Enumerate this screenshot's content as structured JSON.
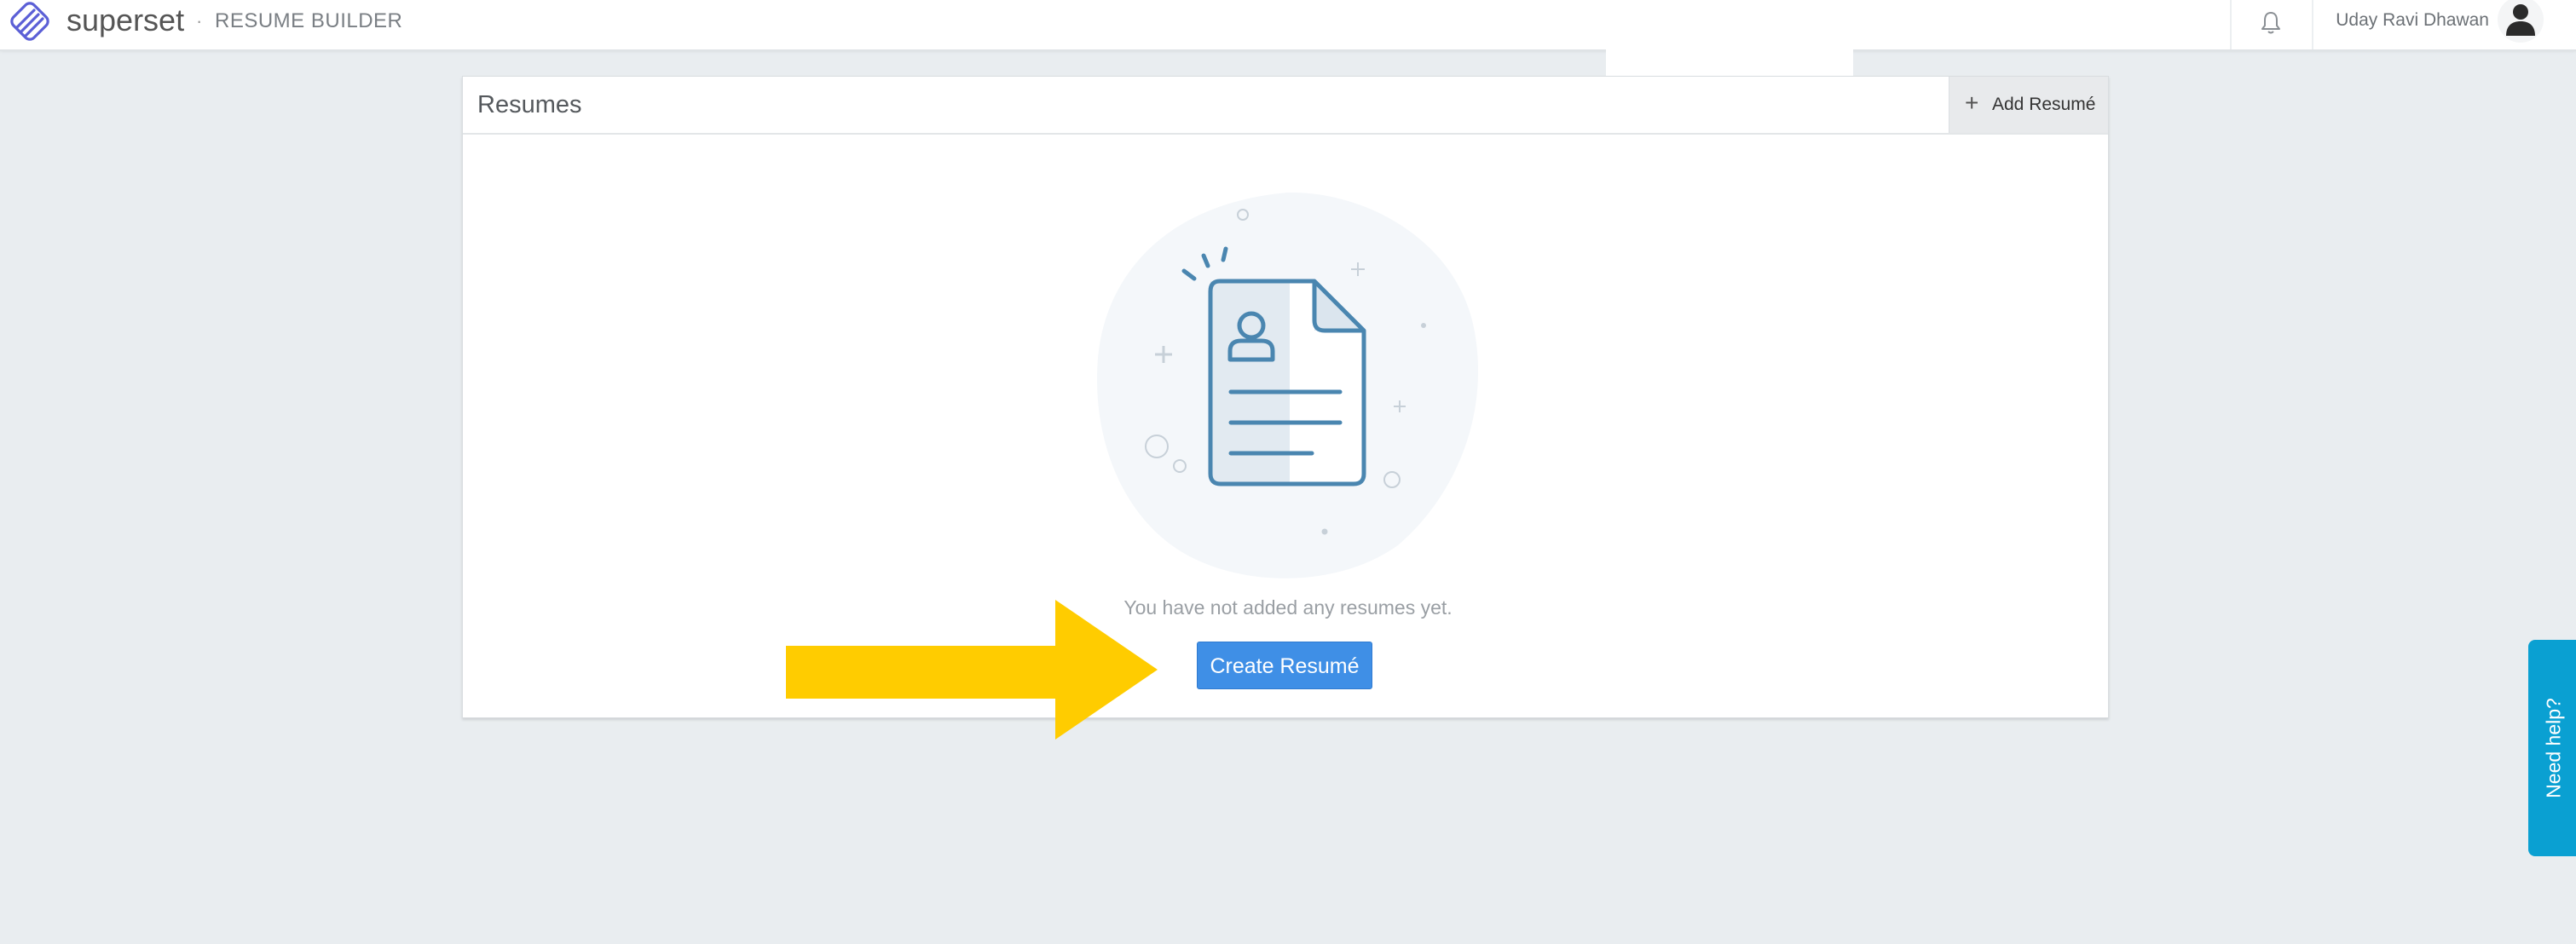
{
  "header": {
    "brand": "superset",
    "separator": "·",
    "product": "RESUME BUILDER",
    "user_name": "Uday Ravi Dhawan",
    "icons": {
      "logo": "superset-logo",
      "notifications": "bell-icon",
      "avatar": "user-avatar-icon"
    }
  },
  "card": {
    "title": "Resumes",
    "add_button_icon": "+",
    "add_button_label": "Add Resumé"
  },
  "empty_state": {
    "illustration": "resume-document-icon",
    "message": "You have not added any resumes yet.",
    "create_button_label": "Create Resumé"
  },
  "annotation": {
    "icon": "yellow-arrow-icon",
    "color": "#ffcc00"
  },
  "help": {
    "label": "Need help?",
    "color": "#0aa0d2"
  },
  "colors": {
    "background": "#e9edf0",
    "primary_button": "#3f8fe6",
    "illustration_stroke": "#4a86b0"
  }
}
